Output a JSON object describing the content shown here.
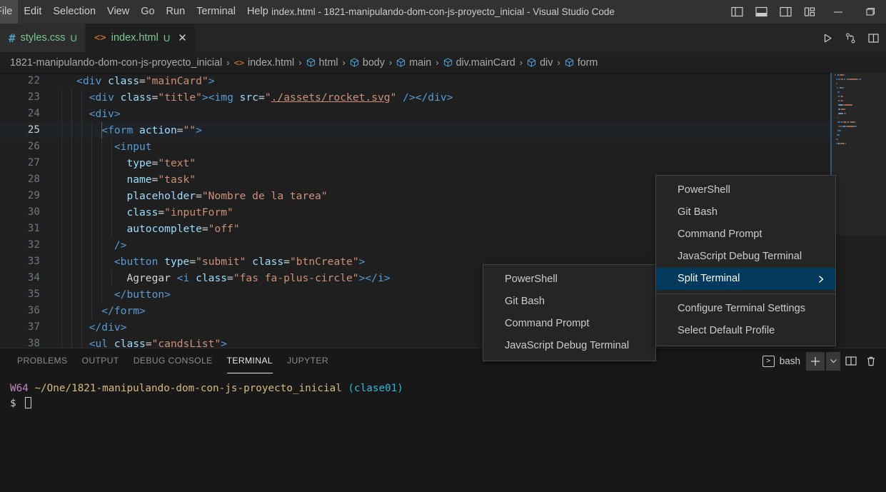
{
  "titlebar": {
    "menus": [
      "File",
      "Edit",
      "Selection",
      "View",
      "Go",
      "Run",
      "Terminal",
      "Help"
    ],
    "window_title": "index.html - 1821-manipulando-dom-con-js-proyecto_inicial - Visual Studio Code",
    "layout_icons": [
      "toggle-primary-sidebar-icon",
      "toggle-panel-icon",
      "toggle-secondary-sidebar-icon",
      "customize-layout-icon"
    ],
    "window_buttons": [
      "minimize-button",
      "maximize-button"
    ]
  },
  "tabs": [
    {
      "name": "styles.css",
      "icon": "css-file-icon",
      "badge": "U",
      "active": false,
      "closable": false
    },
    {
      "name": "index.html",
      "icon": "html-file-icon",
      "badge": "U",
      "active": true,
      "closable": true
    }
  ],
  "tabbar_actions": [
    "run-code-icon",
    "split-source-control-icon",
    "split-editor-icon"
  ],
  "breadcrumb": [
    {
      "label": "1821-manipulando-dom-con-js-proyecto_inicial",
      "icon": ""
    },
    {
      "label": "index.html",
      "icon": "html-file-icon"
    },
    {
      "label": "html",
      "icon": "symbol-html-icon"
    },
    {
      "label": "body",
      "icon": "symbol-html-icon"
    },
    {
      "label": "main",
      "icon": "symbol-html-icon"
    },
    {
      "label": "div.mainCard",
      "icon": "symbol-html-icon"
    },
    {
      "label": "div",
      "icon": "symbol-html-icon"
    },
    {
      "label": "form",
      "icon": "symbol-html-icon"
    }
  ],
  "breadcrumb_separator": "›",
  "editor": {
    "current_line": 25,
    "lines": [
      {
        "n": 22,
        "indent": 0,
        "guides": [],
        "tokens": [
          {
            "t": "    ",
            "c": "t-txt"
          },
          {
            "t": "<div",
            "c": "t-tag"
          },
          {
            "t": " ",
            "c": "t-txt"
          },
          {
            "t": "class",
            "c": "t-attr"
          },
          {
            "t": "=",
            "c": "t-eq"
          },
          {
            "t": "\"mainCard\"",
            "c": "t-str"
          },
          {
            "t": ">",
            "c": "t-tag"
          }
        ]
      },
      {
        "n": 23,
        "indent": 0,
        "guides": [
          14,
          28,
          42
        ],
        "tokens": [
          {
            "t": "      ",
            "c": "t-txt"
          },
          {
            "t": "<div",
            "c": "t-tag"
          },
          {
            "t": " ",
            "c": "t-txt"
          },
          {
            "t": "class",
            "c": "t-attr"
          },
          {
            "t": "=",
            "c": "t-eq"
          },
          {
            "t": "\"title\"",
            "c": "t-str"
          },
          {
            "t": ">",
            "c": "t-tag"
          },
          {
            "t": "<img",
            "c": "t-tag"
          },
          {
            "t": " ",
            "c": "t-txt"
          },
          {
            "t": "src",
            "c": "t-attr"
          },
          {
            "t": "=",
            "c": "t-eq"
          },
          {
            "t": "\"",
            "c": "t-str"
          },
          {
            "t": "./assets/rocket.svg",
            "c": "t-link"
          },
          {
            "t": "\"",
            "c": "t-str"
          },
          {
            "t": " />",
            "c": "t-tag"
          },
          {
            "t": "</div>",
            "c": "t-tag"
          }
        ]
      },
      {
        "n": 24,
        "indent": 0,
        "guides": [
          14,
          28,
          42
        ],
        "tokens": [
          {
            "t": "      ",
            "c": "t-txt"
          },
          {
            "t": "<div>",
            "c": "t-tag"
          }
        ]
      },
      {
        "n": 25,
        "indent": 0,
        "guides": [
          14,
          28,
          42,
          56,
          70
        ],
        "tokens": [
          {
            "t": "        ",
            "c": "t-txt"
          },
          {
            "t": "<form",
            "c": "t-tag"
          },
          {
            "t": " ",
            "c": "t-txt"
          },
          {
            "t": "action",
            "c": "t-attr"
          },
          {
            "t": "=",
            "c": "t-eq"
          },
          {
            "t": "\"\"",
            "c": "t-str"
          },
          {
            "t": ">",
            "c": "t-tag"
          }
        ]
      },
      {
        "n": 26,
        "indent": 0,
        "guides": [
          14,
          28,
          42,
          56,
          70,
          84
        ],
        "tokens": [
          {
            "t": "          ",
            "c": "t-txt"
          },
          {
            "t": "<input",
            "c": "t-tag"
          }
        ]
      },
      {
        "n": 27,
        "indent": 0,
        "guides": [
          14,
          28,
          42,
          56,
          70,
          84
        ],
        "tokens": [
          {
            "t": "            ",
            "c": "t-txt"
          },
          {
            "t": "type",
            "c": "t-attr"
          },
          {
            "t": "=",
            "c": "t-eq"
          },
          {
            "t": "\"text\"",
            "c": "t-str"
          }
        ]
      },
      {
        "n": 28,
        "indent": 0,
        "guides": [
          14,
          28,
          42,
          56,
          70,
          84
        ],
        "tokens": [
          {
            "t": "            ",
            "c": "t-txt"
          },
          {
            "t": "name",
            "c": "t-attr"
          },
          {
            "t": "=",
            "c": "t-eq"
          },
          {
            "t": "\"task\"",
            "c": "t-str"
          }
        ]
      },
      {
        "n": 29,
        "indent": 0,
        "guides": [
          14,
          28,
          42,
          56,
          70,
          84
        ],
        "tokens": [
          {
            "t": "            ",
            "c": "t-txt"
          },
          {
            "t": "placeholder",
            "c": "t-attr"
          },
          {
            "t": "=",
            "c": "t-eq"
          },
          {
            "t": "\"Nombre de la tarea\"",
            "c": "t-str"
          }
        ]
      },
      {
        "n": 30,
        "indent": 0,
        "guides": [
          14,
          28,
          42,
          56,
          70,
          84
        ],
        "tokens": [
          {
            "t": "            ",
            "c": "t-txt"
          },
          {
            "t": "class",
            "c": "t-attr"
          },
          {
            "t": "=",
            "c": "t-eq"
          },
          {
            "t": "\"inputForm\"",
            "c": "t-str"
          }
        ]
      },
      {
        "n": 31,
        "indent": 0,
        "guides": [
          14,
          28,
          42,
          56,
          70,
          84
        ],
        "tokens": [
          {
            "t": "            ",
            "c": "t-txt"
          },
          {
            "t": "autocomplete",
            "c": "t-attr"
          },
          {
            "t": "=",
            "c": "t-eq"
          },
          {
            "t": "\"off\"",
            "c": "t-str"
          }
        ]
      },
      {
        "n": 32,
        "indent": 0,
        "guides": [
          14,
          28,
          42,
          56,
          70
        ],
        "tokens": [
          {
            "t": "          ",
            "c": "t-txt"
          },
          {
            "t": "/>",
            "c": "t-tag"
          }
        ]
      },
      {
        "n": 33,
        "indent": 0,
        "guides": [
          14,
          28,
          42,
          56,
          70
        ],
        "tokens": [
          {
            "t": "          ",
            "c": "t-txt"
          },
          {
            "t": "<button",
            "c": "t-tag"
          },
          {
            "t": " ",
            "c": "t-txt"
          },
          {
            "t": "type",
            "c": "t-attr"
          },
          {
            "t": "=",
            "c": "t-eq"
          },
          {
            "t": "\"submit\"",
            "c": "t-str"
          },
          {
            "t": " ",
            "c": "t-txt"
          },
          {
            "t": "class",
            "c": "t-attr"
          },
          {
            "t": "=",
            "c": "t-eq"
          },
          {
            "t": "\"btnCreate\"",
            "c": "t-str"
          },
          {
            "t": ">",
            "c": "t-tag"
          }
        ]
      },
      {
        "n": 34,
        "indent": 0,
        "guides": [
          14,
          28,
          42,
          56,
          70,
          84
        ],
        "tokens": [
          {
            "t": "            ",
            "c": "t-txt"
          },
          {
            "t": "Agregar ",
            "c": "t-txt"
          },
          {
            "t": "<i",
            "c": "t-tag"
          },
          {
            "t": " ",
            "c": "t-txt"
          },
          {
            "t": "class",
            "c": "t-attr"
          },
          {
            "t": "=",
            "c": "t-eq"
          },
          {
            "t": "\"fas fa-plus-circle\"",
            "c": "t-str"
          },
          {
            "t": ">",
            "c": "t-tag"
          },
          {
            "t": "</i>",
            "c": "t-tag"
          }
        ]
      },
      {
        "n": 35,
        "indent": 0,
        "guides": [
          14,
          28,
          42,
          56,
          70
        ],
        "tokens": [
          {
            "t": "          ",
            "c": "t-txt"
          },
          {
            "t": "</button>",
            "c": "t-tag"
          }
        ]
      },
      {
        "n": 36,
        "indent": 0,
        "guides": [
          14,
          28,
          42,
          56
        ],
        "tokens": [
          {
            "t": "        ",
            "c": "t-txt"
          },
          {
            "t": "</form>",
            "c": "t-tag"
          }
        ]
      },
      {
        "n": 37,
        "indent": 0,
        "guides": [
          14,
          28,
          42
        ],
        "tokens": [
          {
            "t": "      ",
            "c": "t-txt"
          },
          {
            "t": "</div>",
            "c": "t-tag"
          }
        ]
      },
      {
        "n": 38,
        "indent": 0,
        "guides": [
          14,
          28,
          42
        ],
        "tokens": [
          {
            "t": "      ",
            "c": "t-txt"
          },
          {
            "t": "<ul",
            "c": "t-tag"
          },
          {
            "t": " ",
            "c": "t-txt"
          },
          {
            "t": "class",
            "c": "t-attr"
          },
          {
            "t": "=",
            "c": "t-eq"
          },
          {
            "t": "\"candsList\"",
            "c": "t-str"
          },
          {
            "t": ">",
            "c": "t-tag"
          }
        ]
      }
    ]
  },
  "panel": {
    "tabs": [
      {
        "label": "PROBLEMS",
        "active": false
      },
      {
        "label": "OUTPUT",
        "active": false
      },
      {
        "label": "DEBUG CONSOLE",
        "active": false
      },
      {
        "label": "TERMINAL",
        "active": true
      },
      {
        "label": "JUPYTER",
        "active": false
      }
    ],
    "active_terminal": "bash",
    "actions": [
      "new-terminal-icon",
      "terminal-profile-dropdown-icon",
      "split-terminal-icon",
      "kill-terminal-icon"
    ],
    "terminal_lines": [
      {
        "segments": [
          {
            "text": "W64 ",
            "color": "c-magenta"
          },
          {
            "text": "~/One/1821-manipulando-dom-con-js-proyecto_inicial ",
            "color": "c-yellow"
          },
          {
            "text": "(clase01)",
            "color": "c-cyan"
          }
        ]
      },
      {
        "segments": [
          {
            "text": "$ ",
            "color": "c-white"
          }
        ],
        "cursor": true
      }
    ]
  },
  "context_menu": {
    "items": [
      {
        "label": "PowerShell",
        "selected": false,
        "submenu": false
      },
      {
        "label": "Git Bash",
        "selected": false,
        "submenu": false
      },
      {
        "label": "Command Prompt",
        "selected": false,
        "submenu": false
      },
      {
        "label": "JavaScript Debug Terminal",
        "selected": false,
        "submenu": false
      },
      {
        "label": "Split Terminal",
        "selected": true,
        "submenu": true
      },
      {
        "label": "---",
        "separator": true
      },
      {
        "label": "Configure Terminal Settings",
        "selected": false,
        "submenu": false
      },
      {
        "label": "Select Default Profile",
        "selected": false,
        "submenu": false
      }
    ]
  },
  "submenu": {
    "items": [
      {
        "label": "PowerShell"
      },
      {
        "label": "Git Bash"
      },
      {
        "label": "Command Prompt"
      },
      {
        "label": "JavaScript Debug Terminal"
      }
    ]
  },
  "colors": {
    "titlebar_bg": "#323233",
    "editor_bg": "#1f1f1f",
    "panel_bg": "#181818",
    "menu_bg": "#252526",
    "menu_selected": "#04395e",
    "tag": "#569cd6",
    "attribute": "#9cdcfe",
    "string": "#ce9178",
    "git_untracked": "#73c991"
  }
}
